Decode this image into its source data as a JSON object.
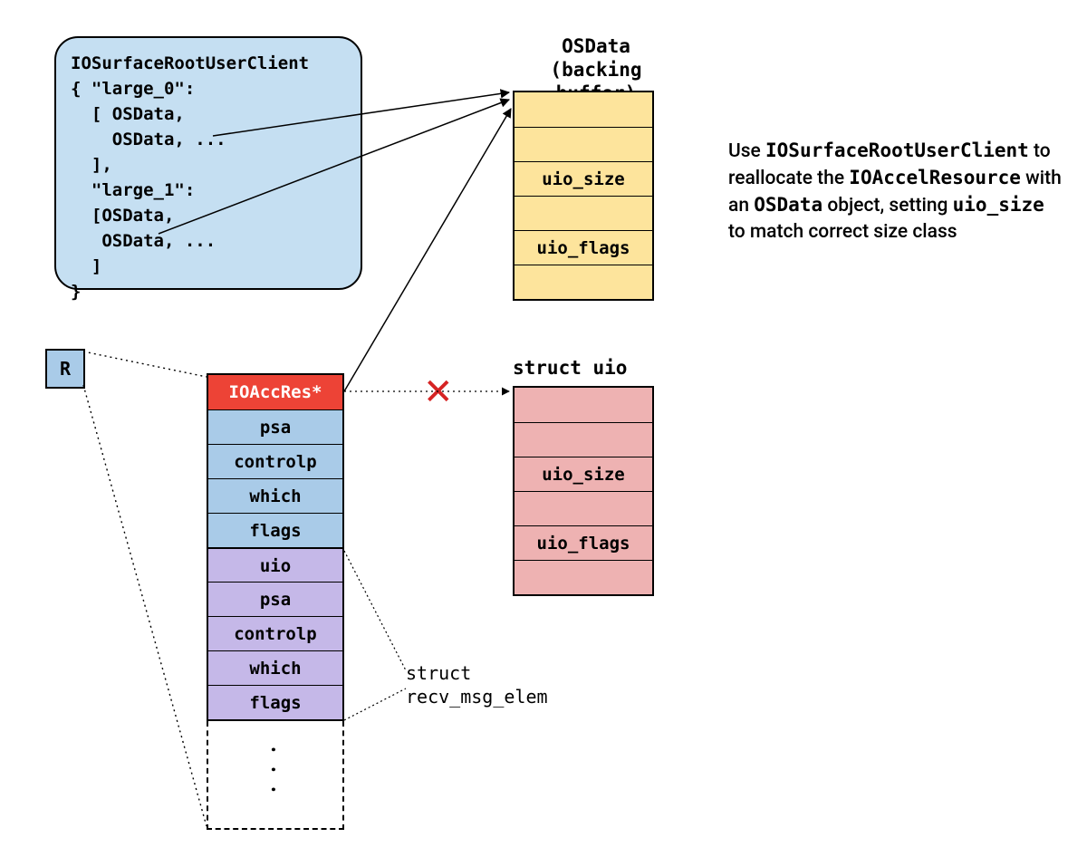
{
  "codeblock": {
    "line1": "IOSurfaceRootUserClient",
    "line2": "{ \"large_0\":",
    "line3": "  [ OSData,",
    "line4": "    OSData, ...",
    "line5": "  ],",
    "line6": "  \"large_1\":",
    "line7": "  [OSData,",
    "line8": "   OSData, ...",
    "line9": "  ]",
    "line10": "}"
  },
  "r_box": "R",
  "stack": {
    "row0": "IOAccRes*",
    "row1": "psa",
    "row2": "controlp",
    "row3": "which",
    "row4": "flags",
    "row5": "uio",
    "row6": "psa",
    "row7": "controlp",
    "row8": "which",
    "row9": "flags"
  },
  "dashed_dots": ". . .",
  "osdata": {
    "title_line1": "OSData",
    "title_line2": "(backing buffer)",
    "row0": "",
    "row1": "",
    "row2": "uio_size",
    "row3": "",
    "row4": "uio_flags",
    "row5": ""
  },
  "uio": {
    "title": "struct uio",
    "row0": "",
    "row1": "",
    "row2": "uio_size",
    "row3": "",
    "row4": "uio_flags",
    "row5": ""
  },
  "recv_label_line1": "struct",
  "recv_label_line2": "recv_msg_elem",
  "explain": {
    "pre1": "Use ",
    "code1": "IOSurfaceRootUserClient",
    "mid1": " to reallocate the ",
    "code2": "IOAccelResource",
    "mid2": " with an ",
    "code3": "OSData",
    "mid3": " object, setting ",
    "code4": "uio_size",
    "post": " to match correct size class"
  }
}
